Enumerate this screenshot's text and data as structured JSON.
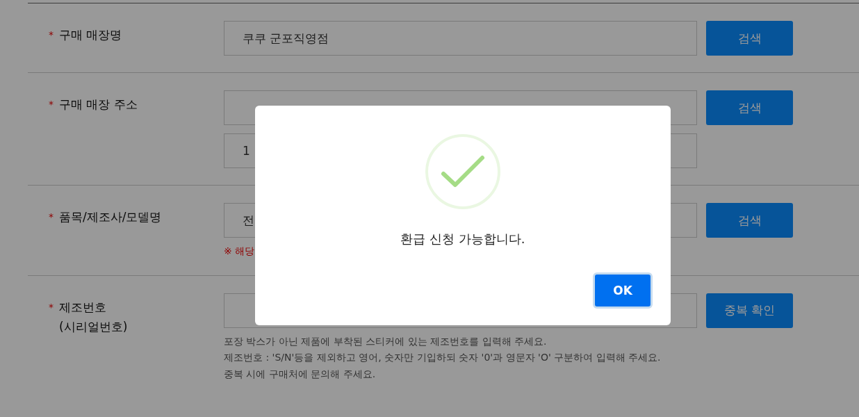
{
  "form": {
    "rows": [
      {
        "marker": "*",
        "label": "구매 매장명",
        "fields": [
          {
            "kind": "input",
            "value": "쿠쿠 군포직영점"
          }
        ],
        "button": "검색",
        "notes": []
      },
      {
        "marker": "*",
        "label": "구매 매장 주소",
        "fields": [
          {
            "kind": "input"
          },
          {
            "kind": "input",
            "value": "1"
          }
        ],
        "button": "검색",
        "notes": []
      },
      {
        "marker": "*",
        "label": "품목/제조사/모델명",
        "fields": [
          {
            "kind": "input",
            "value": "전"
          }
        ],
        "button": "검색",
        "notes": [
          {
            "text": "※ 해당",
            "kind": "warning"
          }
        ]
      },
      {
        "marker": "*",
        "label": "제조번호\n(시리얼번호)",
        "fields": [
          {
            "kind": "input"
          }
        ],
        "button": "중복 확인",
        "notes": [
          {
            "text": "포장 박스가 아닌 제품에 부착된 스티커에 있는 제조번호를 입력해 주세요.",
            "kind": "help"
          },
          {
            "text": "제조번호 : 'S/N'등을 제외하고 영어, 숫자만 기입하되 숫자 '0'과 영문자 'O' 구분하여 입력해 주세요.",
            "kind": "help"
          },
          {
            "text": "중복 시에 구매처에 문의해 주세요.",
            "kind": "help"
          }
        ]
      }
    ]
  },
  "dialog": {
    "kind": "success",
    "message": "환급 신청 가능합니다.",
    "button": "OK"
  }
}
